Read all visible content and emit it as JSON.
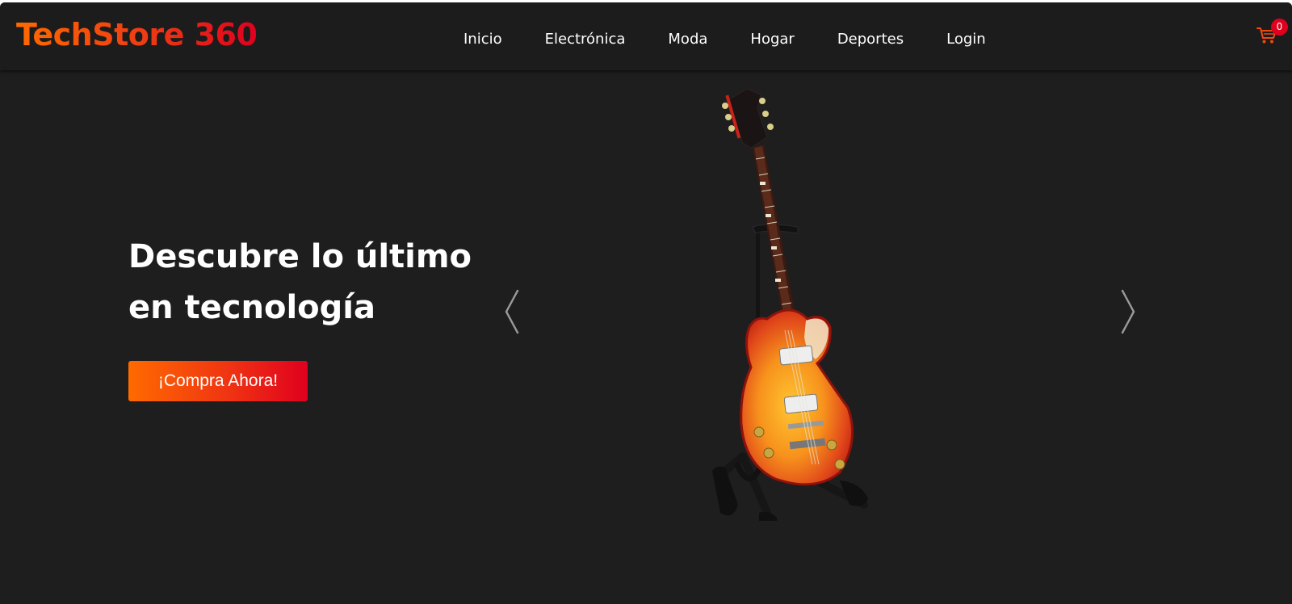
{
  "brand": {
    "name": "TechStore 360"
  },
  "nav": {
    "items": [
      {
        "label": "Inicio"
      },
      {
        "label": "Electrónica"
      },
      {
        "label": "Moda"
      },
      {
        "label": "Hogar"
      },
      {
        "label": "Deportes"
      },
      {
        "label": "Login"
      }
    ]
  },
  "cart": {
    "icon": "shopping-cart-icon",
    "count": "0"
  },
  "hero": {
    "title_line1": "Descubre lo último",
    "title_line2": "en tecnología",
    "cta_label": "¡Compra Ahora!",
    "image": "electric-guitar-on-stand",
    "prev_icon": "chevron-left-icon",
    "next_icon": "chevron-right-icon"
  },
  "colors": {
    "background": "#1e1e1e",
    "navbar": "#1c1c1c",
    "accent_orange": "#ff6a00",
    "accent_red": "#e0001e",
    "text": "#ffffff"
  }
}
